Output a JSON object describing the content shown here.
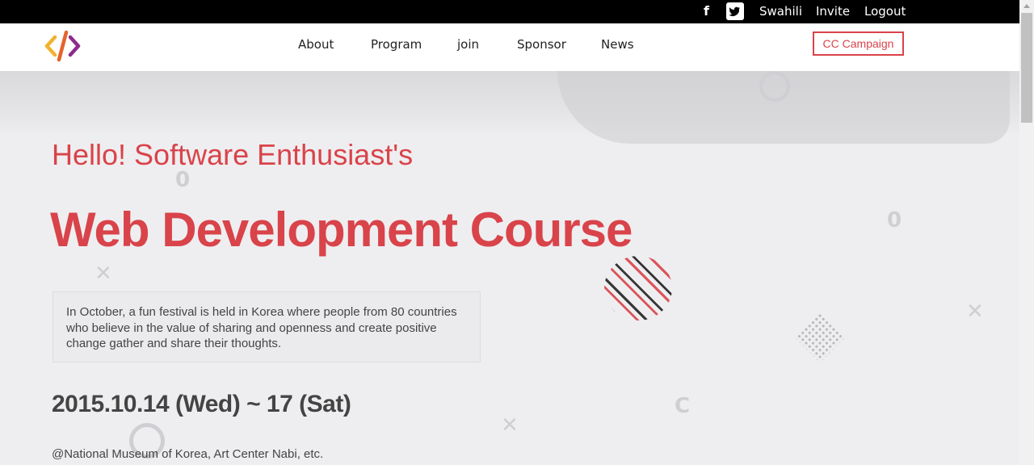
{
  "topbar": {
    "facebook_icon": "facebook-icon",
    "twitter_icon": "twitter-icon",
    "links": [
      "Swahili",
      "Invite",
      "Logout"
    ]
  },
  "nav": {
    "logo_icon": "code-brackets-logo",
    "items": [
      "About",
      "Program",
      "join",
      "Sponsor",
      "News"
    ],
    "cta_label": "CC Campaign"
  },
  "hero": {
    "greeting": "Hello! Software Enthusiast's",
    "headline": "Web Development Course",
    "description": "In October, a fun festival is held in Korea where people from 80 countries who believe in the value of sharing and openness and create positive change gather and share their thoughts.",
    "date": "2015.10.14 (Wed) ~ 17 (Sat)",
    "venue": "@National Museum of Korea, Art Center Nabi, etc."
  },
  "colors": {
    "accent": "#d9434a",
    "topbar": "#000000",
    "hero_bg": "#eeeef0"
  }
}
